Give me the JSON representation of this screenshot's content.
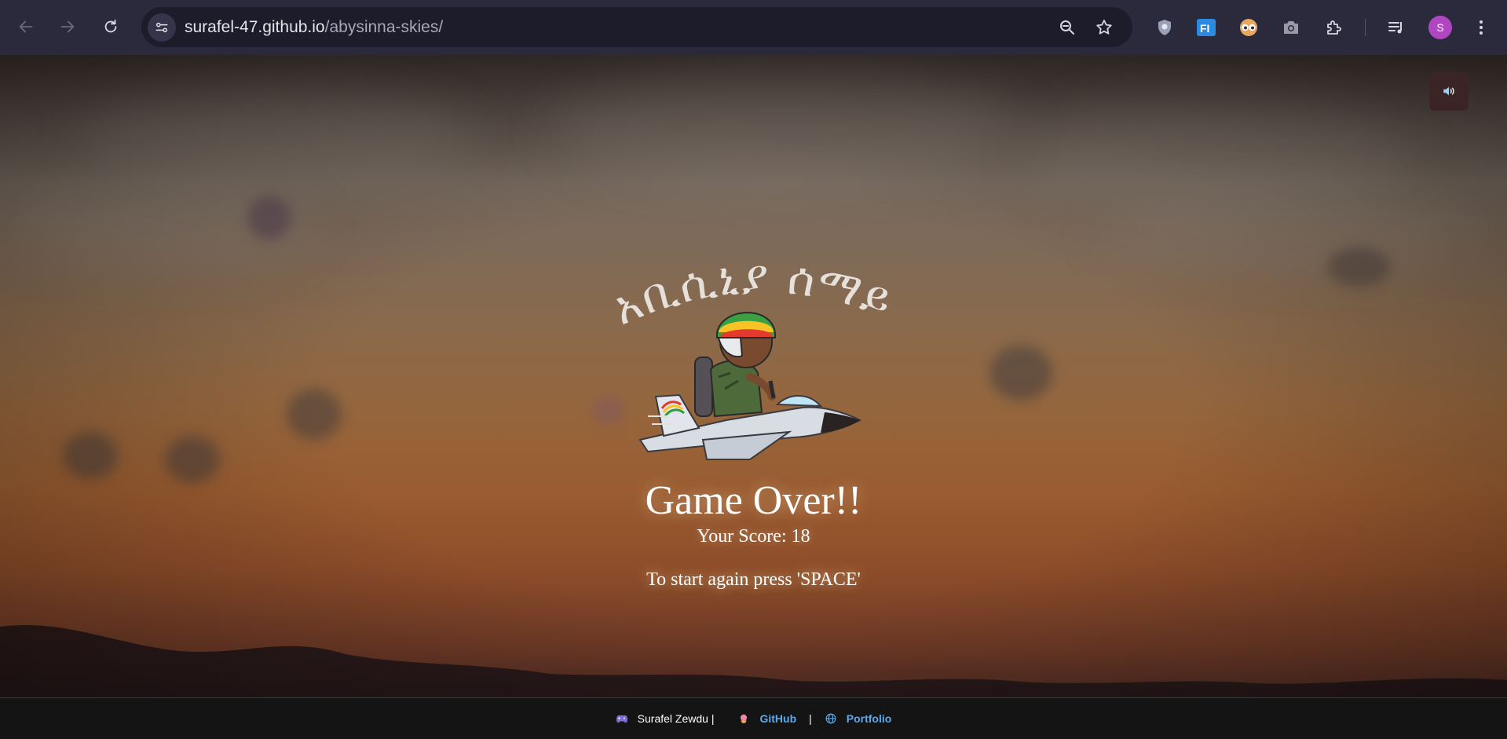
{
  "browser": {
    "url_host": "surafel-47.github.io",
    "url_path": "/abysinna-skies/",
    "profile_initial": "S",
    "icons": [
      "back-icon",
      "forward-icon",
      "reload-icon",
      "site-settings-icon",
      "zoom-icon",
      "bookmark-star-icon",
      "shield-extension-icon",
      "fi-extension-icon",
      "eyes-extension-icon",
      "camera-extension-icon",
      "puzzle-extensions-icon",
      "media-queue-icon",
      "kebab-menu-icon"
    ]
  },
  "game": {
    "title_amharic": "አቢሲኒያ ሰማይ",
    "game_over": "Game Over!!",
    "score_text": "Your Score: 18",
    "restart_text": "To start again press 'SPACE'",
    "sound_icon": "speaker-icon"
  },
  "footer": {
    "author": "Surafel Zewdu |",
    "github_label": "GitHub",
    "separator": "|",
    "portfolio_label": "Portfolio",
    "author_icon": "gamepad-icon",
    "github_icon": "octocat-icon",
    "portfolio_icon": "globe-icon"
  }
}
